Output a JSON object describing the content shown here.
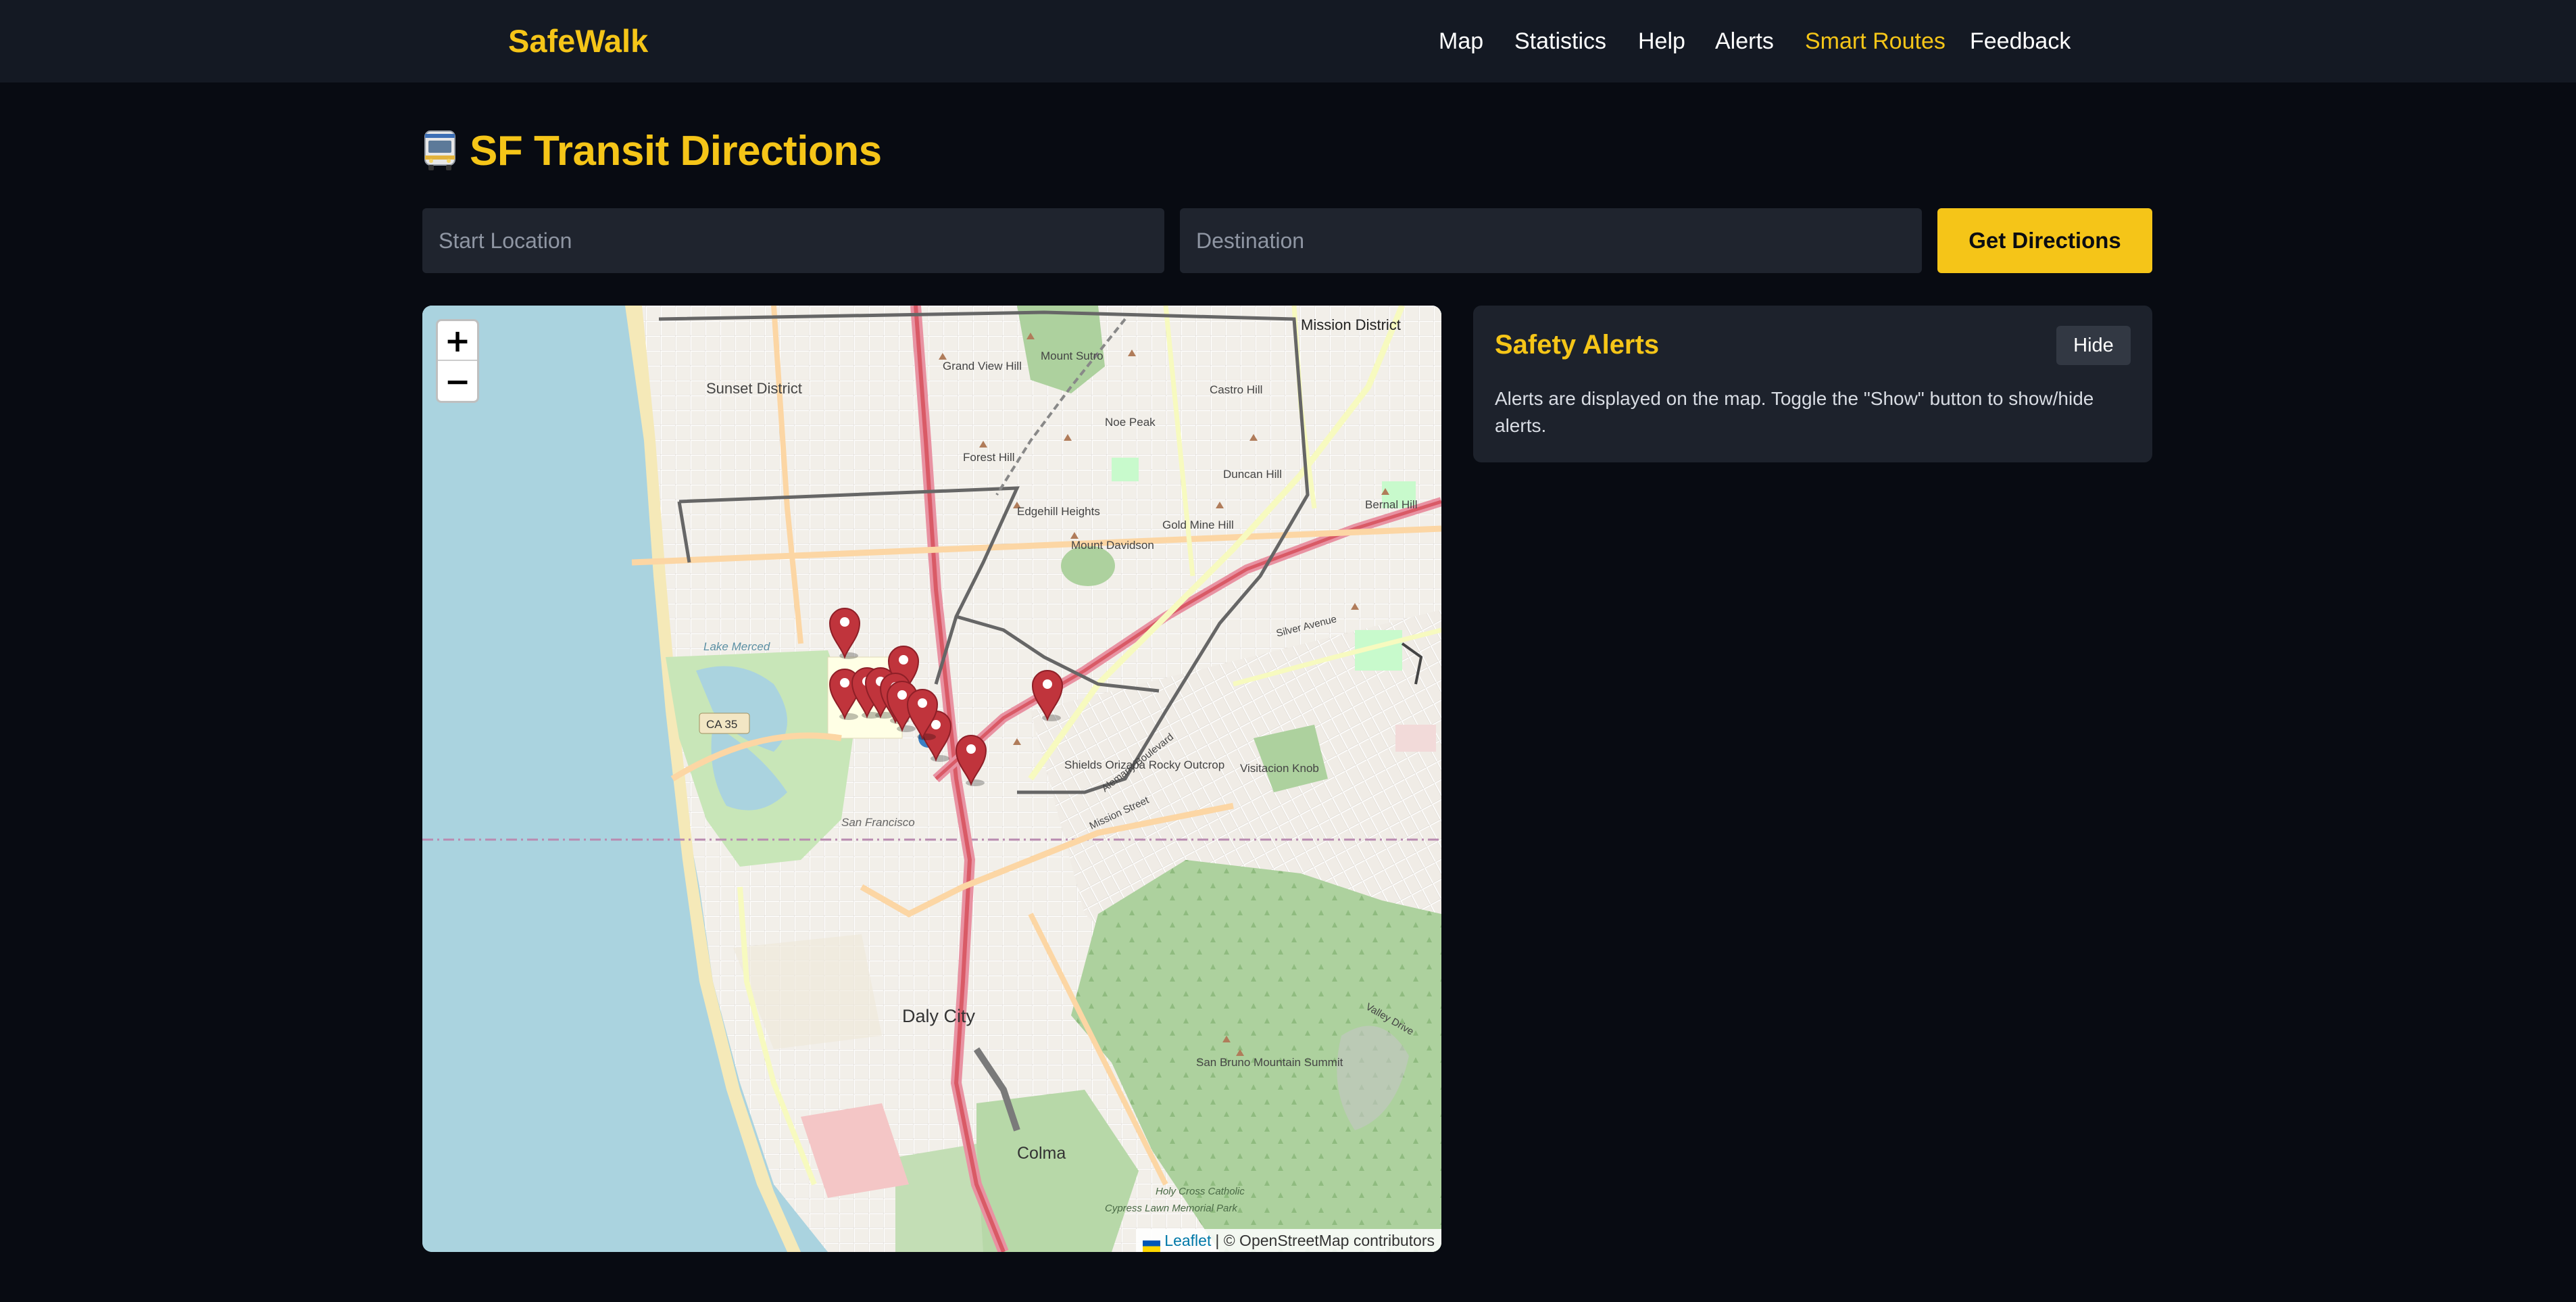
{
  "app": {
    "brand": "SafeWalk"
  },
  "nav": {
    "items": [
      {
        "label": "Map",
        "active": false
      },
      {
        "label": "Statistics",
        "active": false
      },
      {
        "label": "Help",
        "active": false
      },
      {
        "label": "Alerts",
        "active": false
      },
      {
        "label": "Smart Routes",
        "active": true
      },
      {
        "label": "Feedback",
        "active": false
      }
    ]
  },
  "page": {
    "icon": "bus-icon",
    "title": "SF Transit Directions"
  },
  "form": {
    "start_placeholder": "Start Location",
    "start_value": "",
    "destination_placeholder": "Destination",
    "destination_value": "",
    "submit_label": "Get Directions"
  },
  "map": {
    "zoom_in": "+",
    "zoom_out": "−",
    "attribution_link": "Leaflet",
    "attribution_text": "| © OpenStreetMap contributors",
    "labels": {
      "sunset": "Sunset District",
      "mission": "Mission District",
      "lake_merced": "Lake Merced",
      "ca35": "CA 35",
      "daly_city": "Daly City",
      "colma": "Colma",
      "san_francisco": "San Francisco",
      "grand_view": "Grand View Hill",
      "mount_sutro": "Mount Sutro",
      "forest_hill": "Forest Hill",
      "edgehill": "Edgehill Heights",
      "mount_davidson": "Mount Davidson",
      "noe_peak": "Noe Peak",
      "castro_hill": "Castro Hill",
      "duncan_hill": "Duncan Hill",
      "gold_mine": "Gold Mine Hill",
      "bernal": "Bernal Hill",
      "visitacion": "Visitacion Knob",
      "shields": "Shields Orizaba Rocky Outcrop",
      "san_bruno": "San Bruno Mountain Summit",
      "holy_cross": "Holy Cross Catholic",
      "cypress": "Cypress Lawn Memorial Park",
      "silver_ave": "Silver Avenue",
      "mission_st": "Mission Street",
      "alemany": "Alemany Boulevard",
      "valley_dr": "Valley Drive"
    },
    "marker_color": "#c0343c",
    "marker_count": 11
  },
  "alerts": {
    "title": "Safety Alerts",
    "toggle_label": "Hide",
    "description": "Alerts are displayed on the map. Toggle the \"Show\" button to show/hide alerts."
  },
  "colors": {
    "accent": "#f5c518",
    "background": "#080b12",
    "navbar": "#141923",
    "panel": "#1d222c",
    "input": "#1f242e"
  }
}
